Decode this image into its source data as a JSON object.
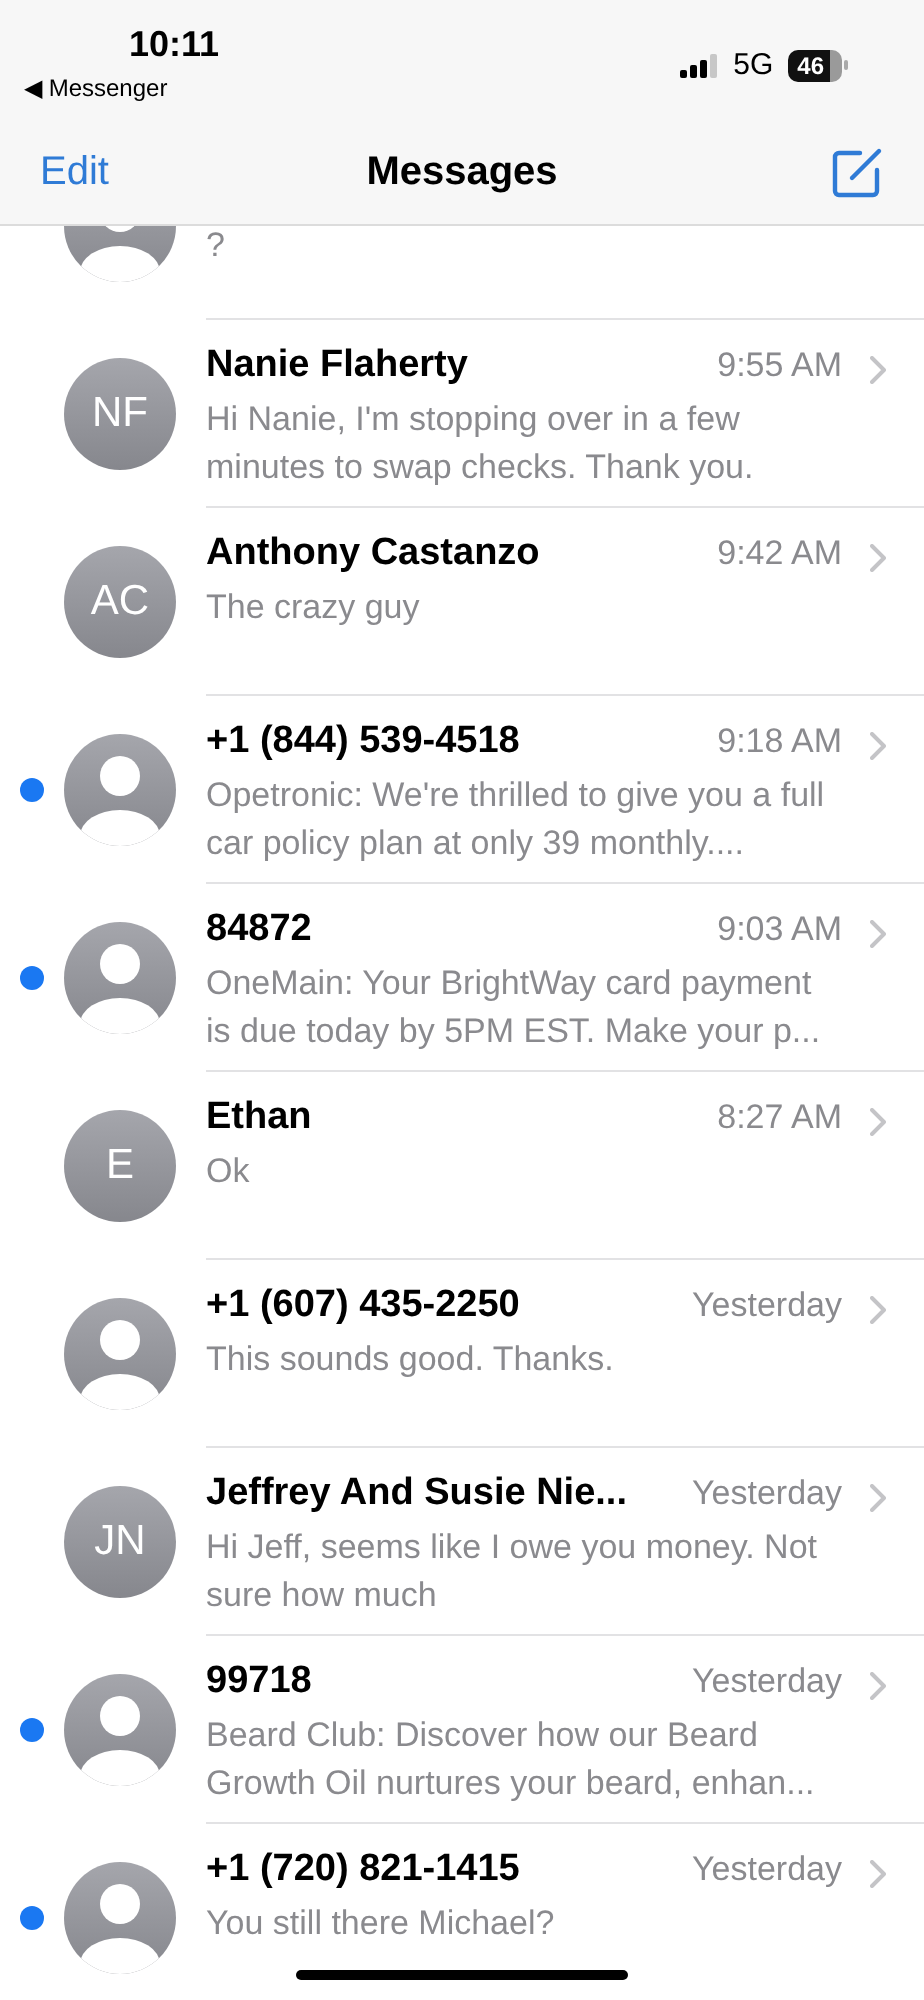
{
  "status_bar": {
    "time": "10:11",
    "back_app": "◀ Messenger",
    "network": "5G",
    "battery": "46"
  },
  "nav_bar": {
    "edit": "Edit",
    "title": "Messages"
  },
  "conversations": [
    {
      "preview": "?",
      "unread": false,
      "avatar": {
        "kind": "silhouette"
      }
    },
    {
      "name": "Nanie Flaherty",
      "time": "9:55 AM",
      "preview": "Hi Nanie, I'm stopping over in a few minutes to swap checks. Thank you.",
      "unread": false,
      "avatar": {
        "kind": "initials",
        "initials": "NF"
      }
    },
    {
      "name": "Anthony Castanzo",
      "time": "9:42 AM",
      "preview": "The crazy guy",
      "unread": false,
      "avatar": {
        "kind": "initials",
        "initials": "AC"
      }
    },
    {
      "name": "+1 (844) 539-4518",
      "time": "9:18 AM",
      "preview": "Opetronic: We're thrilled to give you a full car policy plan at only 39 monthly....",
      "unread": true,
      "avatar": {
        "kind": "silhouette"
      }
    },
    {
      "name": "84872",
      "time": "9:03 AM",
      "preview": "OneMain: Your BrightWay card payment is due today by 5PM EST. Make your p...",
      "unread": true,
      "avatar": {
        "kind": "silhouette"
      }
    },
    {
      "name": "Ethan",
      "time": "8:27 AM",
      "preview": "Ok",
      "unread": false,
      "avatar": {
        "kind": "initials",
        "initials": "E"
      }
    },
    {
      "name": "+1 (607) 435-2250",
      "time": "Yesterday",
      "preview": "This sounds good. Thanks.",
      "unread": false,
      "avatar": {
        "kind": "silhouette"
      }
    },
    {
      "name": "Jeffrey And Susie Nie...",
      "time": "Yesterday",
      "preview": "Hi Jeff, seems like I owe you money. Not sure how much",
      "unread": false,
      "avatar": {
        "kind": "initials",
        "initials": "JN"
      }
    },
    {
      "name": "99718",
      "time": "Yesterday",
      "preview": "Beard Club: Discover how our Beard Growth Oil nurtures your beard, enhan...",
      "unread": true,
      "avatar": {
        "kind": "silhouette"
      }
    },
    {
      "name": "+1 (720) 821-1415",
      "time": "Yesterday",
      "preview": "You still there Michael?",
      "unread": true,
      "avatar": {
        "kind": "silhouette"
      }
    }
  ]
}
